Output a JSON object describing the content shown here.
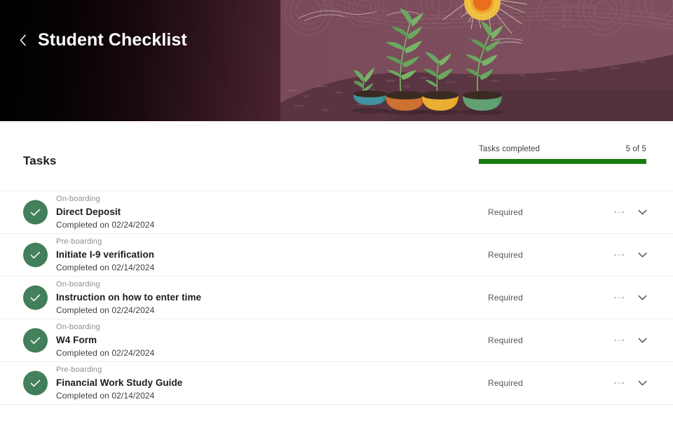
{
  "header": {
    "title": "Student Checklist",
    "back_icon": "chevron-left-icon",
    "gradient_from": "#000000",
    "gradient_to": "#7d4f5d",
    "art": {
      "description": "illustration of four potted seedlings growing in soil under a sun",
      "sun_core_color": "#e8701a",
      "sun_ray_color": "#f3c43f",
      "leaf_color": "#6aa85f",
      "soil_color": "#3a2a22",
      "pots": [
        {
          "name": "pot-teal",
          "color": "#2f8a96"
        },
        {
          "name": "pot-orange",
          "color": "#c9651f"
        },
        {
          "name": "pot-yellow",
          "color": "#e8a51c"
        },
        {
          "name": "pot-green",
          "color": "#559968"
        }
      ]
    }
  },
  "main": {
    "section_title": "Tasks",
    "progress": {
      "label": "Tasks completed",
      "count_text": "5 of 5",
      "completed": 5,
      "total": 5,
      "percent": 100,
      "fill_color": "#167c0b",
      "track_color": "#e4e4e4"
    },
    "tasks": [
      {
        "category": "On-boarding",
        "name": "Direct Deposit",
        "status": "Completed on 02/24/2024",
        "requirement": "Required",
        "check_icon": "check-icon",
        "more_icon": "more-horizontal-icon",
        "expand_icon": "chevron-down-icon"
      },
      {
        "category": "Pre-boarding",
        "name": "Initiate I-9 verification",
        "status": "Completed on 02/14/2024",
        "requirement": "Required",
        "check_icon": "check-icon",
        "more_icon": "more-horizontal-icon",
        "expand_icon": "chevron-down-icon"
      },
      {
        "category": "On-boarding",
        "name": "Instruction on how to enter time",
        "status": "Completed on 02/24/2024",
        "requirement": "Required",
        "check_icon": "check-icon",
        "more_icon": "more-horizontal-icon",
        "expand_icon": "chevron-down-icon"
      },
      {
        "category": "On-boarding",
        "name": "W4 Form",
        "status": "Completed on 02/24/2024",
        "requirement": "Required",
        "check_icon": "check-icon",
        "more_icon": "more-horizontal-icon",
        "expand_icon": "chevron-down-icon"
      },
      {
        "category": "Pre-boarding",
        "name": "Financial Work Study Guide",
        "status": "Completed on 02/14/2024",
        "requirement": "Required",
        "check_icon": "check-icon",
        "more_icon": "more-horizontal-icon",
        "expand_icon": "chevron-down-icon"
      }
    ]
  }
}
